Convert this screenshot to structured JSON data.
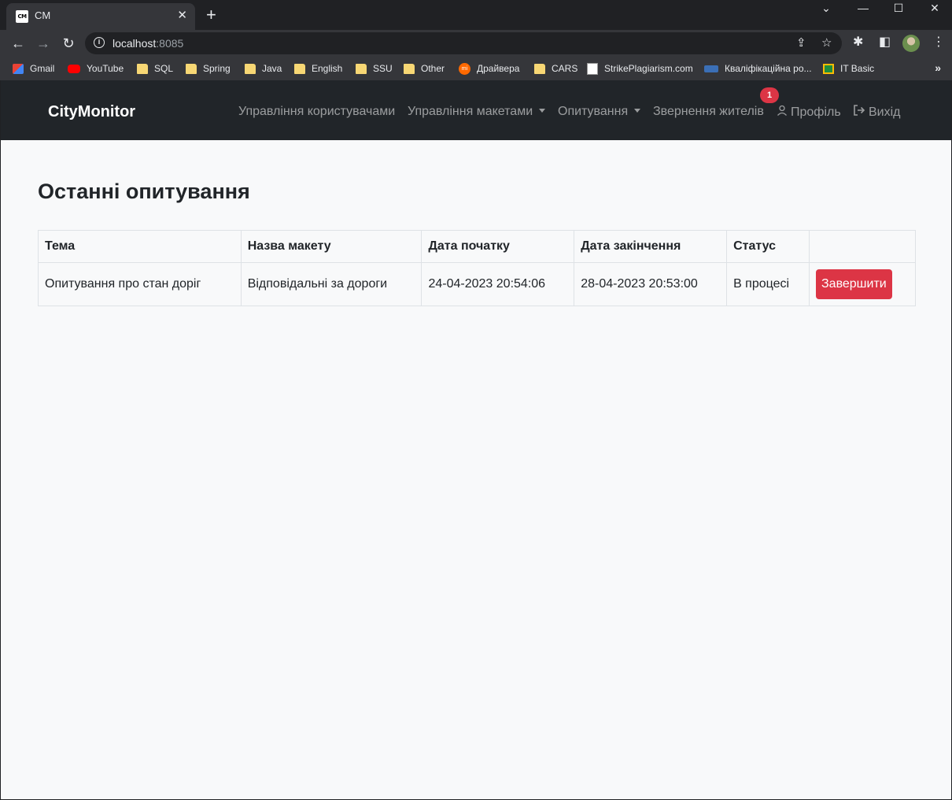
{
  "browser": {
    "tab": {
      "favicon_text": "CM",
      "title": "CM",
      "close": "✕"
    },
    "new_tab": "+",
    "window_controls": {
      "tabsearch": "⌄",
      "minimize": "—",
      "maximize": "☐",
      "close": "✕"
    },
    "nav": {
      "back": "←",
      "forward": "→",
      "reload": "↻"
    },
    "url": {
      "host": "localhost",
      "port": ":8085"
    },
    "bookmarks": [
      {
        "label": "Gmail",
        "icon": "gmail"
      },
      {
        "label": "YouTube",
        "icon": "youtube"
      },
      {
        "label": "SQL",
        "icon": "folder"
      },
      {
        "label": "Spring",
        "icon": "folder"
      },
      {
        "label": "Java",
        "icon": "folder"
      },
      {
        "label": "English",
        "icon": "folder"
      },
      {
        "label": "SSU",
        "icon": "folder"
      },
      {
        "label": "Other",
        "icon": "folder"
      },
      {
        "label": "Драйвера",
        "icon": "mi"
      },
      {
        "label": "CARS",
        "icon": "folder"
      },
      {
        "label": "StrikePlagiarism.com",
        "icon": "doc"
      },
      {
        "label": "Кваліфікаційна ро...",
        "icon": "kval"
      },
      {
        "label": "IT Basic",
        "icon": "it"
      }
    ],
    "bookmarks_more": "»"
  },
  "app": {
    "brand": "CityMonitor",
    "nav": {
      "users": "Управління користувачами",
      "layouts": "Управління макетами",
      "surveys": "Опитування",
      "appeals": "Звернення жителів",
      "appeals_badge": "1",
      "profile": "Профіль",
      "logout": "Вихід"
    },
    "heading": "Останні опитування",
    "table": {
      "headers": [
        "Тема",
        "Назва макету",
        "Дата початку",
        "Дата закінчення",
        "Статус",
        ""
      ],
      "rows": [
        {
          "topic": "Опитування про стан доріг",
          "layout": "Відповідальні за дороги",
          "start": "24-04-2023 20:54:06",
          "end": "28-04-2023 20:53:00",
          "status": "В процесі",
          "action": "Завершити"
        }
      ]
    }
  },
  "colors": {
    "navbar": "#212529",
    "danger": "#dc3545",
    "page_bg": "#f8f9fa"
  }
}
